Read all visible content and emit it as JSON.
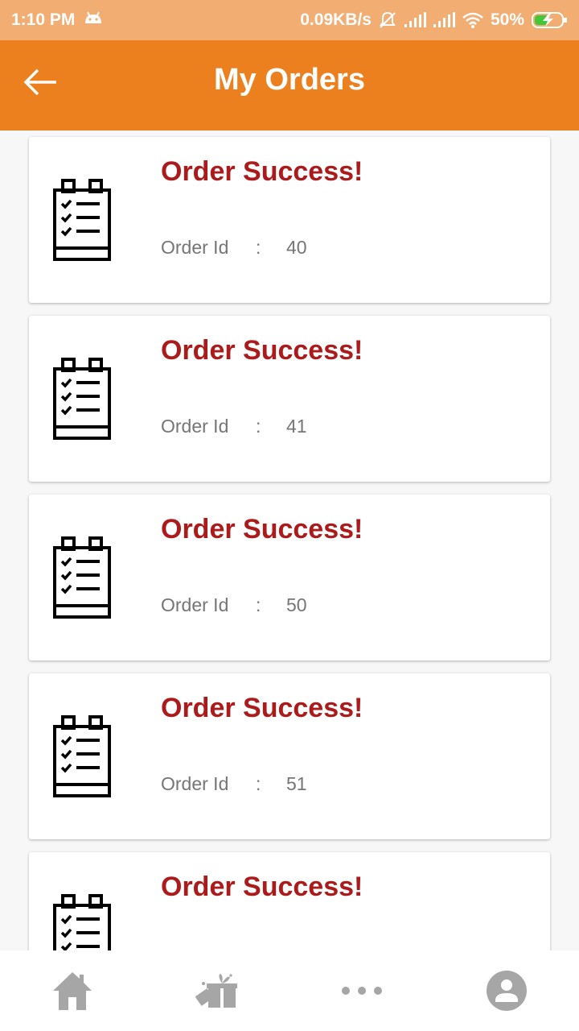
{
  "status_bar": {
    "time": "1:10 PM",
    "net_speed": "0.09KB/s",
    "battery": "50%"
  },
  "header": {
    "title": "My Orders"
  },
  "orders": [
    {
      "title": "Order Success!",
      "id_label": "Order Id",
      "separator": ":",
      "id": "40"
    },
    {
      "title": "Order Success!",
      "id_label": "Order Id",
      "separator": ":",
      "id": "41"
    },
    {
      "title": "Order Success!",
      "id_label": "Order Id",
      "separator": ":",
      "id": "50"
    },
    {
      "title": "Order Success!",
      "id_label": "Order Id",
      "separator": ":",
      "id": "51"
    },
    {
      "title": "Order Success!"
    }
  ],
  "bottom_nav": {
    "items": [
      "home-icon",
      "gift-icon",
      "more-icon",
      "profile-icon"
    ]
  },
  "colors": {
    "status_bar": "#f2ad73",
    "app_bar": "#ec801f",
    "title_red": "#ab1b1b",
    "nav_icon_gray": "#a6a6a6"
  }
}
